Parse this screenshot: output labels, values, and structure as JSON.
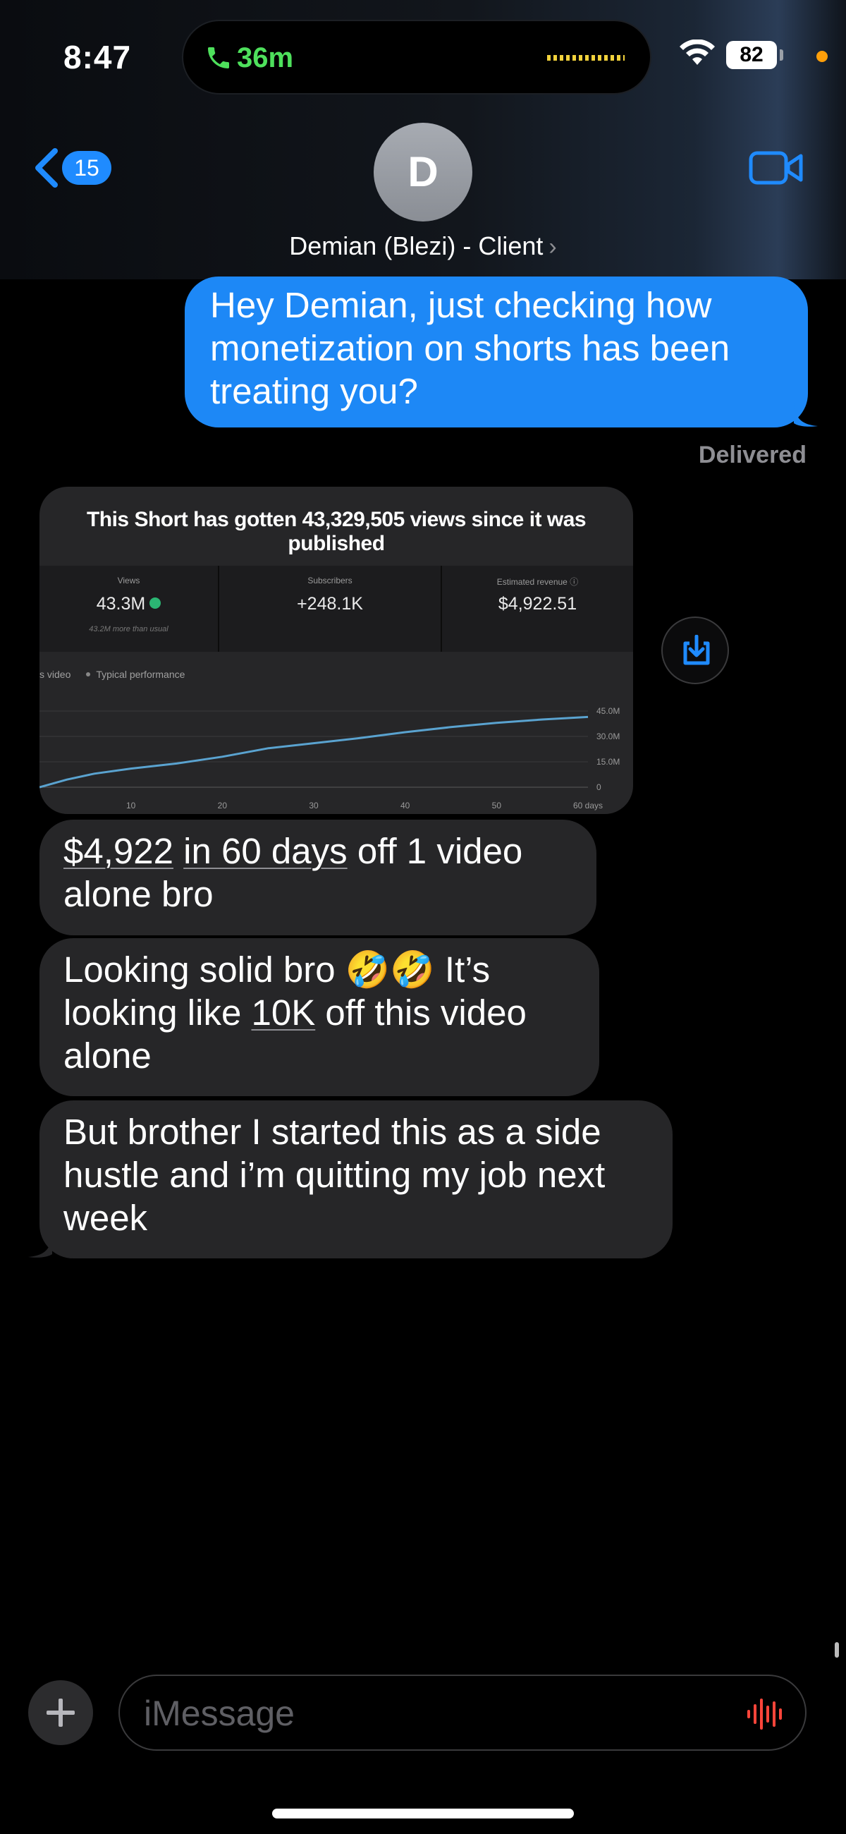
{
  "status_bar": {
    "time": "8:47",
    "call_duration": "36m",
    "battery": "82"
  },
  "header": {
    "back_count": "15",
    "avatar_initial": "D",
    "contact_name": "Demian (Blezi) - Client",
    "contact_chevron": "›"
  },
  "messages": {
    "outgoing_1": "Hey Demian, just checking how monetization on shorts has been treating you?",
    "delivered": "Delivered",
    "attachment": {
      "title": "This Short has gotten 43,329,505 views since it was published",
      "metrics": [
        {
          "label": "Views",
          "value": "43.3M",
          "sub": "43.2M more than usual"
        },
        {
          "label": "Subscribers",
          "value": "+248.1K"
        },
        {
          "label": "Estimated revenue",
          "value": "$4,922.51"
        }
      ],
      "legend": [
        "s video",
        "Typical performance"
      ]
    },
    "incoming_1": {
      "p1": "$4,922",
      "p2": " ",
      "p3": "in 60 days",
      "p4": " off 1 video alone bro"
    },
    "incoming_2": {
      "p1": "Looking solid bro 🤣🤣 It’s looking like ",
      "p2": "10K",
      "p3": " off this video alone"
    },
    "incoming_3": "But brother I started this as a side hustle and i’m quitting my job next week"
  },
  "composer": {
    "placeholder": "iMessage"
  },
  "colors": {
    "outgoing_bubble": "#1d88f6",
    "incoming_bubble": "#262628",
    "call_green": "#4ee05c",
    "accent_blue": "#1f8bff",
    "chart_line": "#5aa3d0"
  },
  "chart_data": {
    "type": "line",
    "title": "",
    "x": [
      0,
      3,
      6,
      10,
      15,
      20,
      25,
      30,
      35,
      40,
      45,
      50,
      55,
      60
    ],
    "series": [
      {
        "values": [
          0,
          4.5,
          8,
          11,
          14,
          18,
          23,
          26,
          29,
          32.5,
          35.5,
          38,
          40,
          41.5
        ]
      }
    ],
    "x_ticks": [
      "10",
      "20",
      "30",
      "40",
      "50",
      "60 days"
    ],
    "y_ticks": [
      "45.0M",
      "30.0M",
      "15.0M",
      "0"
    ],
    "xlim": [
      0,
      60
    ],
    "ylim": [
      0,
      45
    ],
    "ylabel": "",
    "xlabel": "",
    "grid": true
  }
}
